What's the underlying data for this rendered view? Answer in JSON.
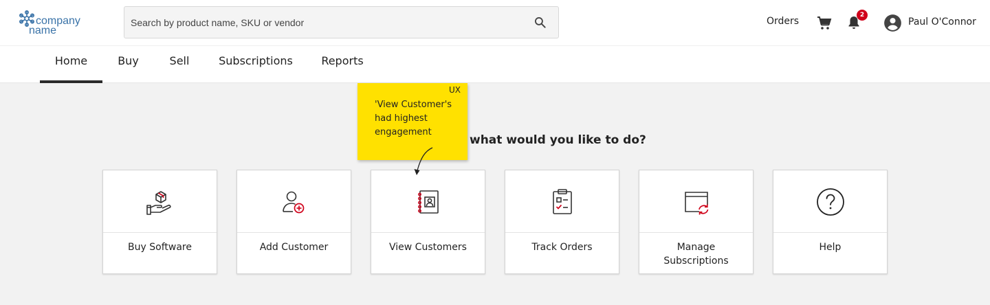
{
  "logo": {
    "line1": "company",
    "line2": "name"
  },
  "search": {
    "placeholder": "Search by product name, SKU or vendor",
    "icon": "search-icon"
  },
  "header": {
    "orders_label": "Orders",
    "cart_icon": "cart-icon",
    "notifications": {
      "icon": "bell-icon",
      "count": "2"
    },
    "user": {
      "avatar_icon": "account-circle-icon",
      "name": "Paul O'Connor"
    }
  },
  "nav": {
    "tabs": [
      {
        "label": "Home",
        "active": true
      },
      {
        "label": "Buy"
      },
      {
        "label": "Sell"
      },
      {
        "label": "Subscriptions"
      },
      {
        "label": "Reports"
      }
    ]
  },
  "main": {
    "heading": "what would you like to do?",
    "cards": [
      {
        "label": "Buy Software",
        "icon": "hand-box-icon"
      },
      {
        "label": "Add Customer",
        "icon": "add-user-icon"
      },
      {
        "label": "View Customers",
        "icon": "contacts-book-icon"
      },
      {
        "label": "Track Orders",
        "icon": "clipboard-checklist-icon"
      },
      {
        "label": "Manage Subscriptions",
        "icon": "window-refresh-icon"
      },
      {
        "label": "Help",
        "icon": "question-circle-icon"
      }
    ]
  },
  "annotation": {
    "tag": "UX",
    "note": "'View Customer's had highest engagement"
  },
  "colors": {
    "accent": "#d0021b",
    "brand": "#3a73a8",
    "sticky": "#ffe100"
  }
}
